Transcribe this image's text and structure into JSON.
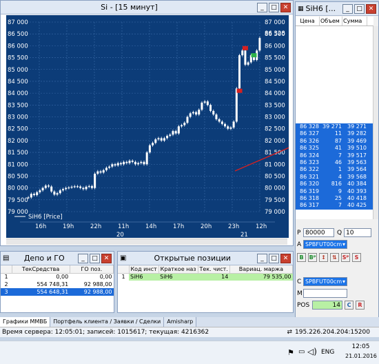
{
  "chart_window": {
    "title": "Si - [15 минут]",
    "legend": "SiH6 [Price]",
    "min_label": "_",
    "max_label": "□",
    "close_label": "✕"
  },
  "chart_data": {
    "type": "candlestick",
    "ylim": [
      79000,
      87000
    ],
    "yticks": [
      "87 000",
      "86 500",
      "86 000",
      "85 500",
      "85 000",
      "84 500",
      "84 000",
      "83 500",
      "83 000",
      "82 500",
      "82 000",
      "81 500",
      "81 000",
      "80 500",
      "80 000",
      "79 500",
      "79 000"
    ],
    "y_tick_values": [
      87000,
      86500,
      86000,
      85500,
      85000,
      84500,
      84000,
      83500,
      83000,
      82500,
      82000,
      81500,
      81000,
      80500,
      80000,
      79500,
      79000
    ],
    "xticks": [
      "16h",
      "19h",
      "22h",
      "11h",
      "14h",
      "17h",
      "20h",
      "23h",
      "12h"
    ],
    "day_labels": [
      "20",
      "21"
    ],
    "last_price": "86 328",
    "series": [
      {
        "values": [
          79600,
          79750,
          79700,
          79820,
          79900,
          80000,
          80100,
          80060,
          79850,
          79720,
          79780,
          79900,
          79950,
          80000,
          80020,
          80050,
          80070,
          80060,
          80000,
          79950,
          80050,
          80080,
          80000,
          80600,
          80700,
          80650,
          80750,
          80850,
          80900,
          81000,
          80950,
          81050,
          81000,
          81100,
          81050,
          81150,
          81100,
          81000,
          81050,
          81100,
          81000,
          81500,
          81800,
          81900,
          82050,
          82100,
          82000,
          82100,
          82200,
          82250,
          82400,
          82300,
          82600,
          82650,
          82750,
          83000,
          83150,
          83200,
          83100,
          83300,
          83600,
          83650,
          83500,
          83250,
          83100,
          82900,
          82800,
          82700,
          82600,
          82500,
          82550,
          82800,
          84200,
          85600,
          85800,
          85200,
          85300,
          85600,
          85400,
          85800,
          86328
        ]
      }
    ],
    "markers": [
      {
        "type": "sell",
        "x_index": 75,
        "y": 85900,
        "color": "#d62020"
      },
      {
        "type": "sell",
        "x_index": 73,
        "y": 84100,
        "color": "#d62020"
      },
      {
        "type": "buy",
        "x_index": 78,
        "y": 85600,
        "color": "#2db34a"
      }
    ]
  },
  "book_window": {
    "title": "SiH6 [...",
    "headers": [
      "Цена",
      "Объем",
      "Сумма"
    ],
    "rows": [
      [
        "86 328",
        "39 271",
        "39 271"
      ],
      [
        "86 327",
        "11",
        "39 282"
      ],
      [
        "86 326",
        "87",
        "39 469"
      ],
      [
        "86 325",
        "41",
        "39 510"
      ],
      [
        "86 324",
        "7",
        "39 517"
      ],
      [
        "86 323",
        "46",
        "39 563"
      ],
      [
        "86 322",
        "1",
        "39 564"
      ],
      [
        "86 321",
        "4",
        "39 568"
      ],
      [
        "86 320",
        "816",
        "40 384"
      ],
      [
        "86 319",
        "9",
        "40 393"
      ],
      [
        "86 318",
        "25",
        "40 418"
      ],
      [
        "86 317",
        "7",
        "40 425"
      ]
    ],
    "price_label": "P",
    "price_value": "80000",
    "qty_label": "Q",
    "qty_value": "10",
    "account_label": "A",
    "account_value": "SPBFUT00cm",
    "order_buttons": [
      "B",
      "Bᴾ",
      "↕",
      "⇅",
      "Sᴾ",
      "S"
    ],
    "client_label": "C",
    "client_value": "SPBFUT00cm",
    "comment_label": "M",
    "comment_value": "",
    "pos_label": "POS",
    "pos_value": "14",
    "c_label": "C",
    "r_label": "R"
  },
  "depo_window": {
    "title": "Депо и ГО",
    "headers": [
      "",
      "ТекСредства",
      "ГО поз."
    ],
    "rows": [
      [
        "1",
        "0,00",
        "0,00"
      ],
      [
        "2",
        "554 748,31",
        "92 988,00"
      ],
      [
        "3",
        "554 648,31",
        "92 988,00"
      ]
    ]
  },
  "pos_window": {
    "title": "Открытые позиции",
    "headers": [
      "",
      "Код инст",
      "Краткое наз",
      "Тек. чист.",
      "Вариац. маржа"
    ],
    "rows": [
      [
        "1",
        "SiH6",
        "SiH6",
        "14",
        "79 535,00"
      ]
    ]
  },
  "tabs": [
    "Графики ММВБ",
    "Портфель клиента / Заявки / Сделки",
    "Amisharp"
  ],
  "status": {
    "left": "Время сервера: 12:05:01; записей: 1015617; текущая: 4216362",
    "right": "195.226.204.204:15200"
  },
  "taskbar": {
    "lang": "ENG",
    "time": "12:05",
    "date": "21.01.2016"
  }
}
